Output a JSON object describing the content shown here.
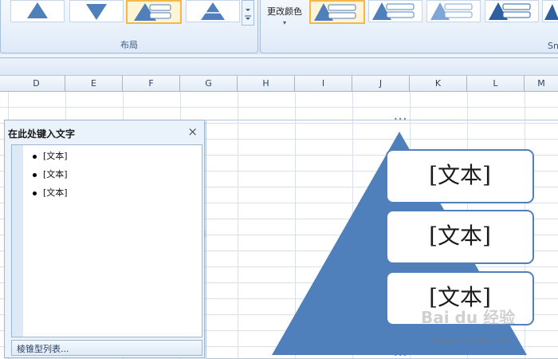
{
  "ribbon": {
    "layout_group_label": "布局",
    "change_color_label": "更改颜色",
    "smartart_styles_label": "Sn",
    "dropdown_arrow": "▾"
  },
  "columns": [
    "D",
    "E",
    "F",
    "G",
    "H",
    "I",
    "J",
    "K",
    "L",
    "M"
  ],
  "text_pane": {
    "title": "在此处键入文字",
    "close": "×",
    "items": [
      "[文本]",
      "[文本]",
      "[文本]"
    ],
    "footer": "棱锥型列表..."
  },
  "smartart": {
    "boxes": [
      "[文本]",
      "[文本]",
      "[文本]"
    ],
    "pyramid_color": "#4f80bc",
    "box_border_color": "#4f80bc",
    "grip_dots": "•••"
  },
  "watermark": {
    "text": "Bai du 经验",
    "url": "jingyan.baidu.com"
  }
}
